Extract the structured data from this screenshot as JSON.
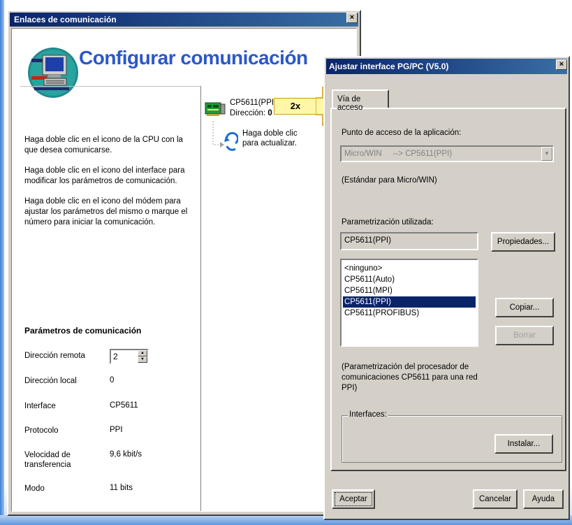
{
  "window1": {
    "title": "Enlaces de comunicación",
    "close_label": "×",
    "heading": "Configurar comunicación",
    "instructions": [
      "Haga doble clic en el icono de la CPU con la que desea comunicarse.",
      "Haga doble clic en el icono del interface para modificar los parámetros de comunicación.",
      "Haga doble clic en el icono del módem para ajustar los parámetros del mismo o marque el número para iniciar la comunicación."
    ],
    "params_title": "Parámetros de comunicación",
    "params": {
      "remote_label": "Dirección remota",
      "remote_value": "2",
      "local_label": "Dirección local",
      "local_value": "0",
      "interface_label": "Interface",
      "interface_value": "CP5611",
      "protocol_label": "Protocolo",
      "protocol_value": "PPI",
      "speed_label": "Velocidad de transferencia",
      "speed_value": "9,6 kbit/s",
      "mode_label": "Modo",
      "mode_value": "11 bits"
    },
    "device": {
      "name": "CP5611(PPI)",
      "address_label": "Dirección:",
      "address_value": "0"
    },
    "refresh_text": "Haga doble clic para actualizar.",
    "callout": "2x"
  },
  "window2": {
    "title": "Ajustar interface PG/PC (V5.0)",
    "close_label": "×",
    "tab_label": "Vía de acceso",
    "access_point_label": "Punto de acceso de la aplicación:",
    "access_point_value": "Micro/WIN     --> CP5611(PPI)",
    "access_point_note": "(Estándar para Micro/WIN)",
    "param_label": "Parametrización utilizada:",
    "param_value": "CP5611(PPI)",
    "list_items": [
      "<ninguno>",
      "CP5611(Auto)",
      "CP5611(MPI)",
      "CP5611(PPI)",
      "CP5611(PROFIBUS)"
    ],
    "selected_index": 3,
    "properties_button": "Propiedades...",
    "copy_button": "Copiar...",
    "delete_button": "Borrar",
    "description": "(Parametrización del procesador de comunicaciones CP5611 para una red PPI)",
    "interfaces_group": "Interfaces:",
    "install_button": "Instalar...",
    "ok_button": "Aceptar",
    "cancel_button": "Cancelar",
    "help_button": "Ayuda"
  },
  "colors": {
    "title_bar_start": "#0a246a",
    "title_bar_end": "#3a6ea5",
    "heading_blue": "#2b57c8",
    "selection": "#0a246a",
    "window_face": "#d4d0c8"
  }
}
